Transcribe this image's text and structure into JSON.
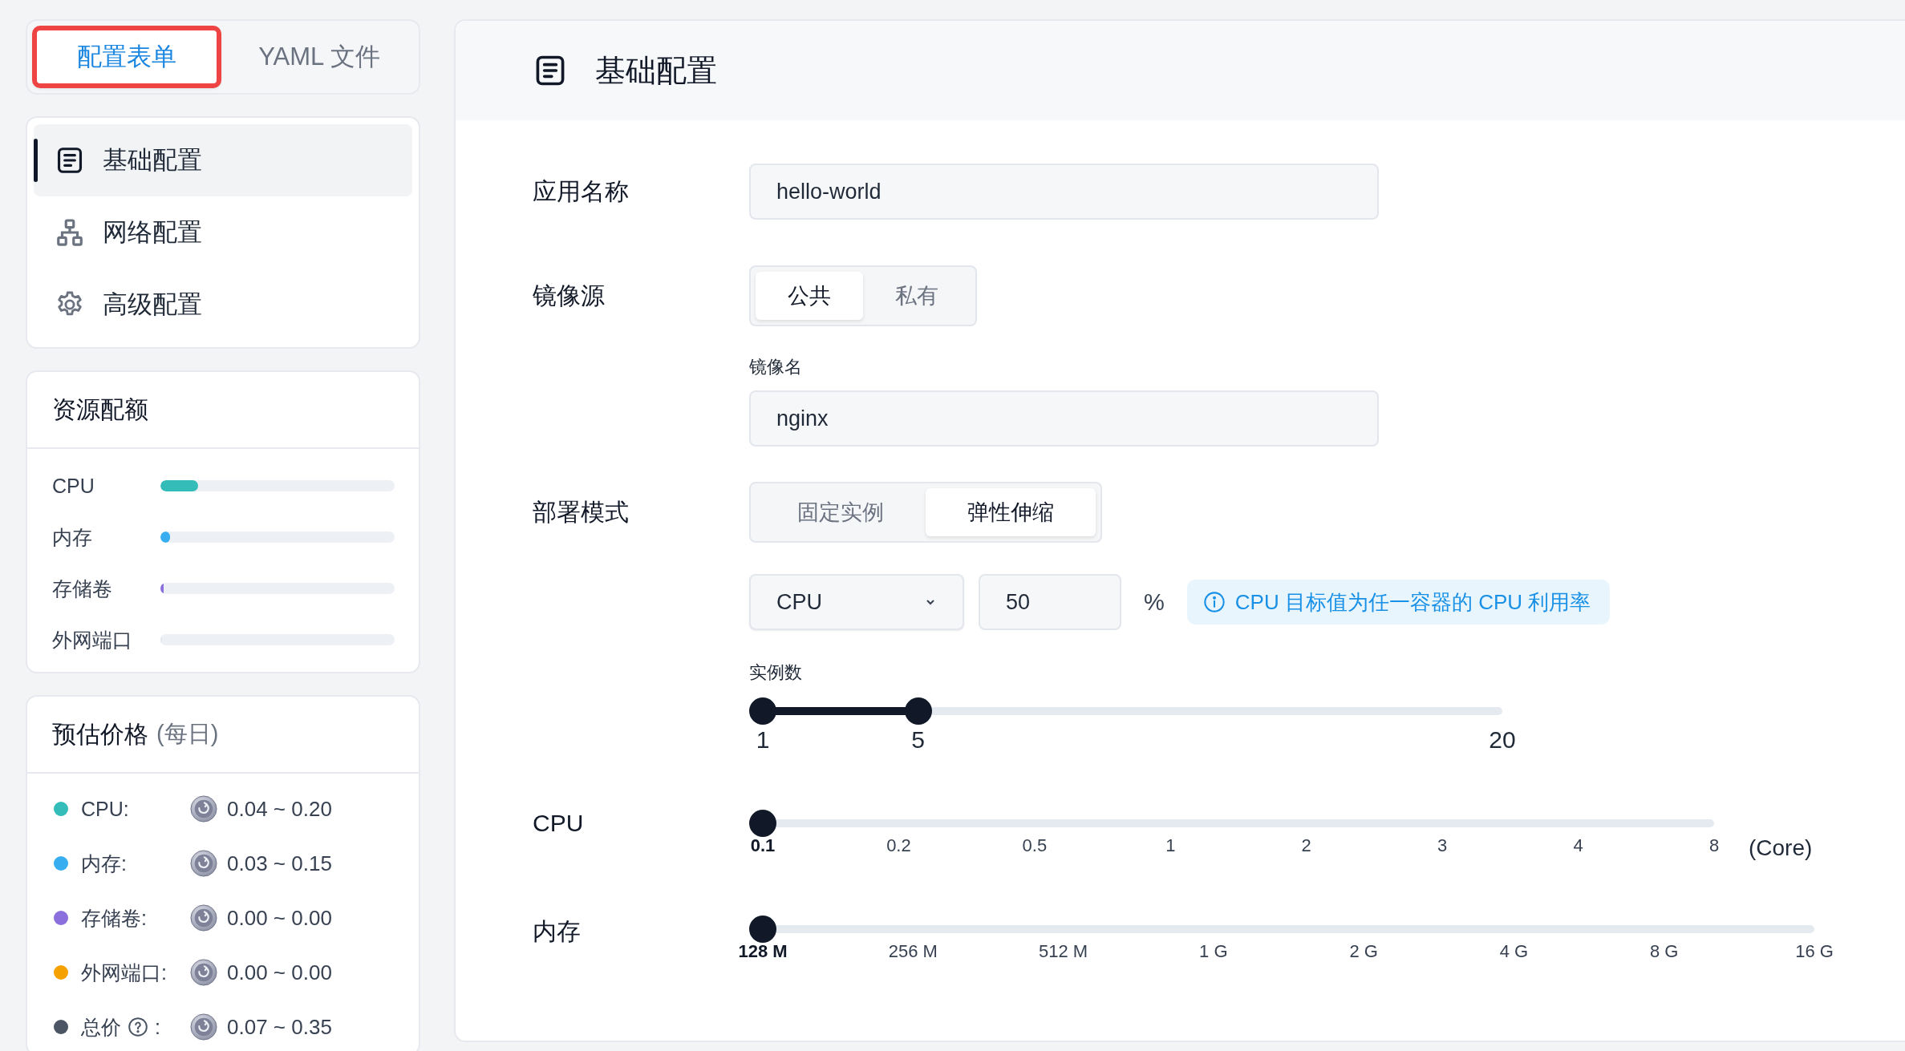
{
  "mode_tabs": [
    {
      "label": "配置表单",
      "selected": true,
      "highlighted": true
    },
    {
      "label": "YAML 文件",
      "selected": false,
      "highlighted": false
    }
  ],
  "nav": [
    {
      "label": "基础配置",
      "kind": "document",
      "selected": true
    },
    {
      "label": "网络配置",
      "kind": "network",
      "selected": false
    },
    {
      "label": "高级配置",
      "kind": "gear",
      "selected": false
    }
  ],
  "resources": {
    "title": "资源配额",
    "rows": [
      {
        "label": "CPU",
        "level": 0.16,
        "color": "#34bcb8"
      },
      {
        "label": "内存",
        "level": 0.04,
        "color": "#38aef0"
      },
      {
        "label": "存储卷",
        "level": 0.015,
        "color": "#8b6fdc"
      },
      {
        "label": "外网端口",
        "level": 0
      }
    ]
  },
  "price": {
    "title": "预估价格",
    "subtitle": "(每日)",
    "rows": [
      {
        "label": "CPU:",
        "value": "0.04 ~ 0.20",
        "color": "#34bcb8"
      },
      {
        "label": "内存:",
        "value": "0.03 ~ 0.15",
        "color": "#38aef0"
      },
      {
        "label": "存储卷:",
        "value": "0.00 ~ 0.00",
        "color": "#8b6fdc"
      },
      {
        "label": "外网端口:",
        "value": "0.00 ~ 0.00",
        "color": "#f5a100"
      },
      {
        "label": "总价",
        "help": true,
        "after_help": ":",
        "value": "0.07 ~ 0.35",
        "color": "#4b5563"
      }
    ]
  },
  "panel": {
    "title": "基础配置",
    "app_name": {
      "label": "应用名称",
      "value": "hello-world"
    },
    "image_source": {
      "label": "镜像源",
      "options": [
        {
          "label": "公共",
          "selected": true
        },
        {
          "label": "私有",
          "selected": false
        }
      ],
      "image_name_label": "镜像名",
      "image_name": "nginx"
    },
    "deploy_mode": {
      "label": "部署模式",
      "options": [
        {
          "label": "固定实例",
          "selected": false
        },
        {
          "label": "弹性伸缩",
          "selected": true
        }
      ],
      "metric": "CPU",
      "target": "50",
      "unit": "%",
      "hint": "CPU 目标值为任一容器的 CPU 利用率",
      "instances": {
        "label": "实例数",
        "thumbs": [
          {
            "level": 0,
            "label": "1"
          },
          {
            "level": 0.21,
            "label": "5"
          }
        ],
        "max_label": "20"
      }
    },
    "cpu": {
      "label": "CPU",
      "level": 0,
      "ticks": [
        "0.1",
        "0.2",
        "0.5",
        "1",
        "2",
        "3",
        "4",
        "8"
      ],
      "unit": "(Core)"
    },
    "memory": {
      "label": "内存",
      "level": 0,
      "ticks": [
        "128 M",
        "256 M",
        "512 M",
        "1 G",
        "2 G",
        "4 G",
        "8 G",
        "16 G"
      ]
    }
  }
}
